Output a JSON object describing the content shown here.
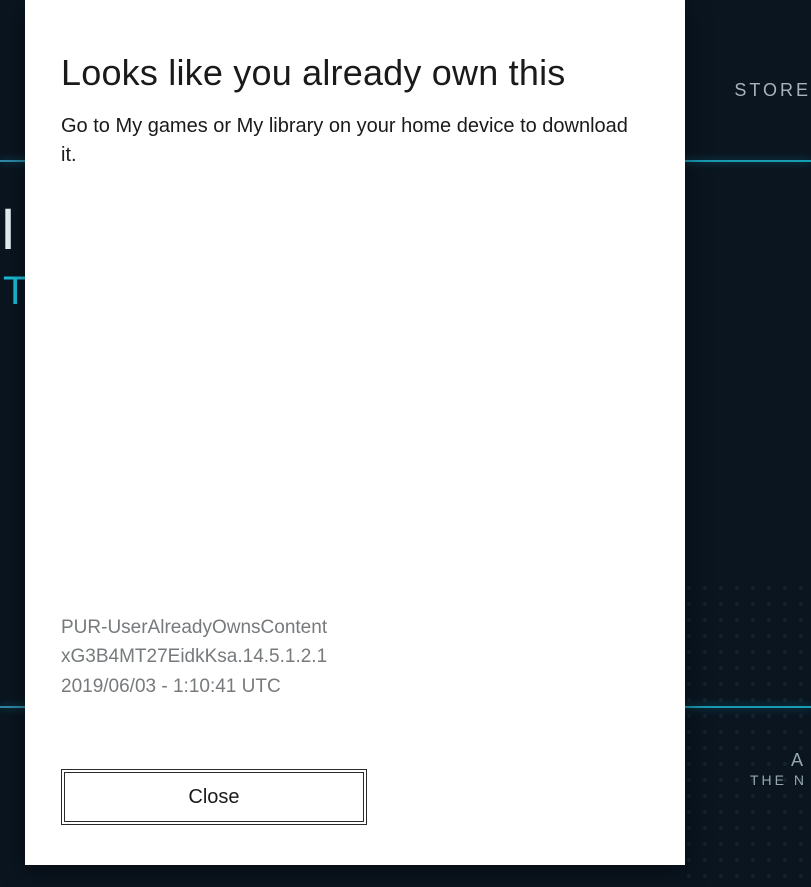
{
  "background": {
    "store_label": "STORE",
    "partial_letter": "I",
    "accent_letter": "T",
    "tile_line1": "A",
    "tile_line2": "THE N"
  },
  "dialog": {
    "title": "Looks like you already own this",
    "body": "Go to My games or My library on your home device to download it."
  },
  "error": {
    "code": "PUR-UserAlreadyOwnsContent",
    "reference": "xG3B4MT27EidkKsa.14.5.1.2.1",
    "timestamp": "2019/06/03 - 1:10:41 UTC"
  },
  "buttons": {
    "close": "Close"
  }
}
